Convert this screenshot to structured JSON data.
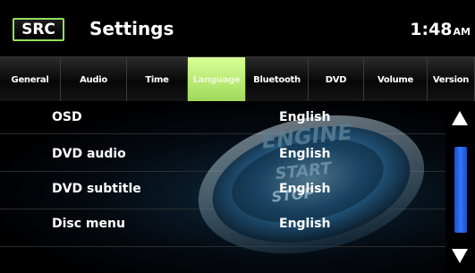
{
  "header": {
    "src_label": "SRC",
    "title": "Settings",
    "time": "1:48",
    "ampm": "AM"
  },
  "tabs": [
    {
      "label": "General",
      "active": false
    },
    {
      "label": "Audio",
      "active": false
    },
    {
      "label": "Time",
      "active": false
    },
    {
      "label": "Language",
      "active": true
    },
    {
      "label": "Bluetooth",
      "active": false
    },
    {
      "label": "DVD",
      "active": false
    },
    {
      "label": "Volume",
      "active": false
    },
    {
      "label": "Version",
      "active": false
    }
  ],
  "settings": [
    {
      "label": "OSD",
      "value": "English"
    },
    {
      "label": "DVD audio",
      "value": "English"
    },
    {
      "label": "DVD subtitle",
      "value": "English"
    },
    {
      "label": "Disc menu",
      "value": "English"
    }
  ],
  "background": {
    "engine_text": "ENGINE",
    "start_text": "START",
    "stop_text": "STOP"
  },
  "colors": {
    "accent_green": "#9fd85a",
    "scroll_blue": "#2f77ff"
  },
  "icons": {
    "scroll_up": "triangle-up-icon",
    "scroll_down": "triangle-down-icon"
  }
}
